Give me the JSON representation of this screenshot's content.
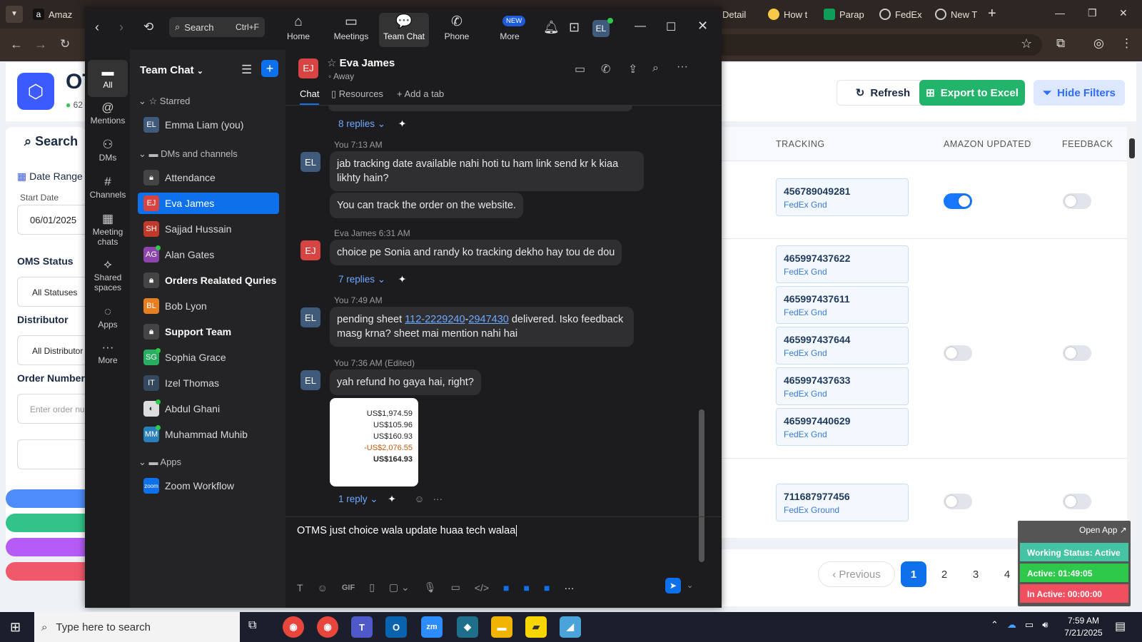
{
  "browser": {
    "tabs": [
      {
        "label": "Amaz",
        "color": "#1a1a1a"
      },
      {
        "label": "Detail",
        "color": "#333"
      },
      {
        "label": "How t",
        "color": "#f7c948"
      },
      {
        "label": "Parap",
        "color": "#0f9d58"
      },
      {
        "label": "FedEx",
        "color": "#777"
      },
      {
        "label": "New T",
        "color": "#777"
      }
    ],
    "new_tab": "+",
    "window_controls": [
      "—",
      "❐",
      "✕"
    ]
  },
  "webapp": {
    "brand": "OT",
    "brand_sub": "62",
    "search_label": "Search",
    "date_range_label": "Date Range",
    "start_date_label": "Start Date",
    "start_date_value": "06/01/2025",
    "oms_status_label": "OMS Status",
    "oms_status_value": "All Statuses",
    "distributor_label": "Distributor",
    "distributor_value": "All Distributor",
    "order_number_label": "Order Number",
    "order_number_placeholder": "Enter order nu",
    "refresh_label": "Refresh",
    "export_label": "Export to Excel",
    "hide_filters_label": "Hide Filters",
    "columns": [
      "TRACKING",
      "AMAZON UPDATED",
      "FEEDBACK"
    ],
    "rows": [
      {
        "tracking": [
          {
            "num": "456789049281",
            "carrier": "FedEx Gnd"
          }
        ],
        "amazon_updated": true,
        "feedback": false
      },
      {
        "tracking": [
          {
            "num": "465997437622",
            "carrier": "FedEx Gnd"
          },
          {
            "num": "465997437611",
            "carrier": "FedEx Gnd"
          },
          {
            "num": "465997437644",
            "carrier": "FedEx Gnd"
          },
          {
            "num": "465997437633",
            "carrier": "FedEx Gnd"
          },
          {
            "num": "465997440629",
            "carrier": "FedEx Gnd"
          }
        ],
        "amazon_updated": false,
        "feedback": false
      },
      {
        "tracking": [
          {
            "num": "711687977456",
            "carrier": "FedEx Ground"
          }
        ],
        "amazon_updated": false,
        "feedback": false
      }
    ],
    "pagination": {
      "previous": "Previous",
      "pages": [
        "1",
        "2",
        "3",
        "4"
      ],
      "current": "1"
    },
    "status_widget": {
      "open_app": "Open App ↗",
      "working_status": "Working Status: Active",
      "active": "Active: 01:49:05",
      "inactive": "In Active: 00:00:00"
    }
  },
  "zoom": {
    "search_label": "Search",
    "search_shortcut": "Ctrl+F",
    "nav": [
      {
        "label": "Home",
        "icon": "home-icon"
      },
      {
        "label": "Meetings",
        "icon": "video-icon"
      },
      {
        "label": "Team Chat",
        "icon": "chat-icon"
      },
      {
        "label": "Phone",
        "icon": "phone-icon"
      },
      {
        "label": "More",
        "icon": "more-icon"
      }
    ],
    "new_badge": "NEW",
    "user_initials": "EL",
    "rail": [
      {
        "label": "All"
      },
      {
        "label": "Mentions"
      },
      {
        "label": "DMs"
      },
      {
        "label": "Channels"
      },
      {
        "label": "Meeting chats"
      },
      {
        "label": "Shared spaces"
      },
      {
        "label": "Apps"
      },
      {
        "label": "More"
      }
    ],
    "sidebar_title": "Team Chat",
    "sections": {
      "starred": "Starred",
      "dms": "DMs and channels",
      "apps": "Apps"
    },
    "sidebar_items": [
      {
        "initials": "EL",
        "name": "Emma Liam (you)",
        "color": "#3f5a7a"
      },
      {
        "initials": "",
        "name": "Attendance",
        "color": "#444"
      },
      {
        "initials": "EJ",
        "name": "Eva James",
        "color": "#d64541"
      },
      {
        "initials": "SH",
        "name": "Sajjad Hussain",
        "color": "#c0392b"
      },
      {
        "initials": "AG",
        "name": "Alan Gates",
        "color": "#8e44ad"
      },
      {
        "initials": "",
        "name": "Orders Realated Quries",
        "color": "#444"
      },
      {
        "initials": "BL",
        "name": "Bob Lyon",
        "color": "#e67e22"
      },
      {
        "initials": "",
        "name": "Support Team",
        "color": "#444"
      },
      {
        "initials": "SG",
        "name": "Sophia Grace",
        "color": "#27ae60"
      },
      {
        "initials": "IT",
        "name": "Izel Thomas",
        "color": "#34495e"
      },
      {
        "initials": "",
        "name": "Abdul Ghani",
        "color": "#999"
      },
      {
        "initials": "MM",
        "name": "Muhammad Muhib",
        "color": "#2980b9"
      },
      {
        "initials": "zoom",
        "name": "Zoom Workflow",
        "color": "#0e71eb"
      }
    ],
    "chat": {
      "contact_initials": "EJ",
      "contact_name": "Eva James",
      "contact_status": "Away",
      "tabs": [
        "Chat",
        "Resources",
        "Add a tab"
      ],
      "messages": {
        "replies_1": "8 replies",
        "m1_meta": "You 7:13 AM",
        "m1_text": "jab tracking date available nahi hoti tu ham link send kr k kiaa likhty hain?",
        "m1b_text": "You can track the order on the website.",
        "m2_meta": "Eva James 6:31 AM",
        "m2_text": "choice pe Sonia and randy ko tracking dekho hay tou de dou",
        "replies_2": "7 replies",
        "m3_meta": "You 7:49 AM",
        "m3_text_a": "pending sheet ",
        "m3_link1": "112-2229240",
        "m3_dash": "-",
        "m3_link2": "2947430",
        "m3_text_b": " delivered. Isko feedback masg krna? sheet mai mention nahi hai",
        "m4_meta": "You 7:36 AM (Edited)",
        "m4_text": "yah refund ho gaya hai, right?",
        "receipt": [
          "US$1,974.59",
          "US$105.96",
          "US$160.93",
          "-US$2,076.55",
          "US$164.93"
        ],
        "replies_3": "1 reply"
      },
      "composer_text": "OTMS just choice wala update huaa tech walaa"
    }
  },
  "taskbar": {
    "search_placeholder": "Type here to search",
    "time": "7:59 AM",
    "date": "7/21/2025"
  }
}
